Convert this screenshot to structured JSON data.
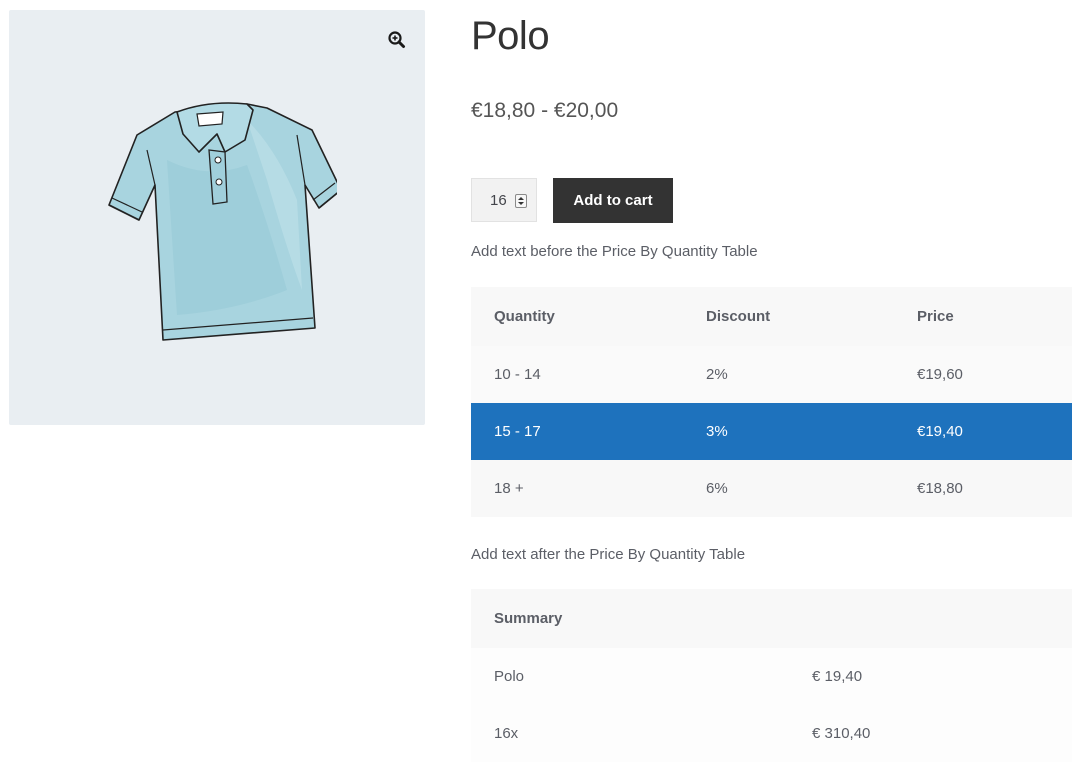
{
  "product": {
    "title": "Polo",
    "price_range": "€18,80 - €20,00",
    "image_icon": "polo-shirt-image",
    "zoom_icon": "zoom-in-icon"
  },
  "cart": {
    "quantity": "16",
    "add_to_cart_label": "Add to cart"
  },
  "notes": {
    "before_table": "Add text before the Price By Quantity Table",
    "after_table": "Add text after the Price By Quantity Table"
  },
  "price_table": {
    "headers": [
      "Quantity",
      "Discount",
      "Price"
    ],
    "rows": [
      {
        "quantity": "10 - 14",
        "discount": "2%",
        "price": "€19,60",
        "selected": false
      },
      {
        "quantity": "15 - 17",
        "discount": "3%",
        "price": "€19,40",
        "selected": true
      },
      {
        "quantity": "18 +",
        "discount": "6%",
        "price": "€18,80",
        "selected": false
      }
    ],
    "selected_color": "#1e72bd"
  },
  "summary_table": {
    "header": "Summary",
    "rows": [
      {
        "label": "Polo",
        "value": "€ 19,40"
      },
      {
        "label": "16x",
        "value": "€ 310,40"
      }
    ]
  },
  "colors": {
    "button_bg": "#333333",
    "gallery_bg": "#e9eef2",
    "shirt_fill": "#a8d4df"
  }
}
